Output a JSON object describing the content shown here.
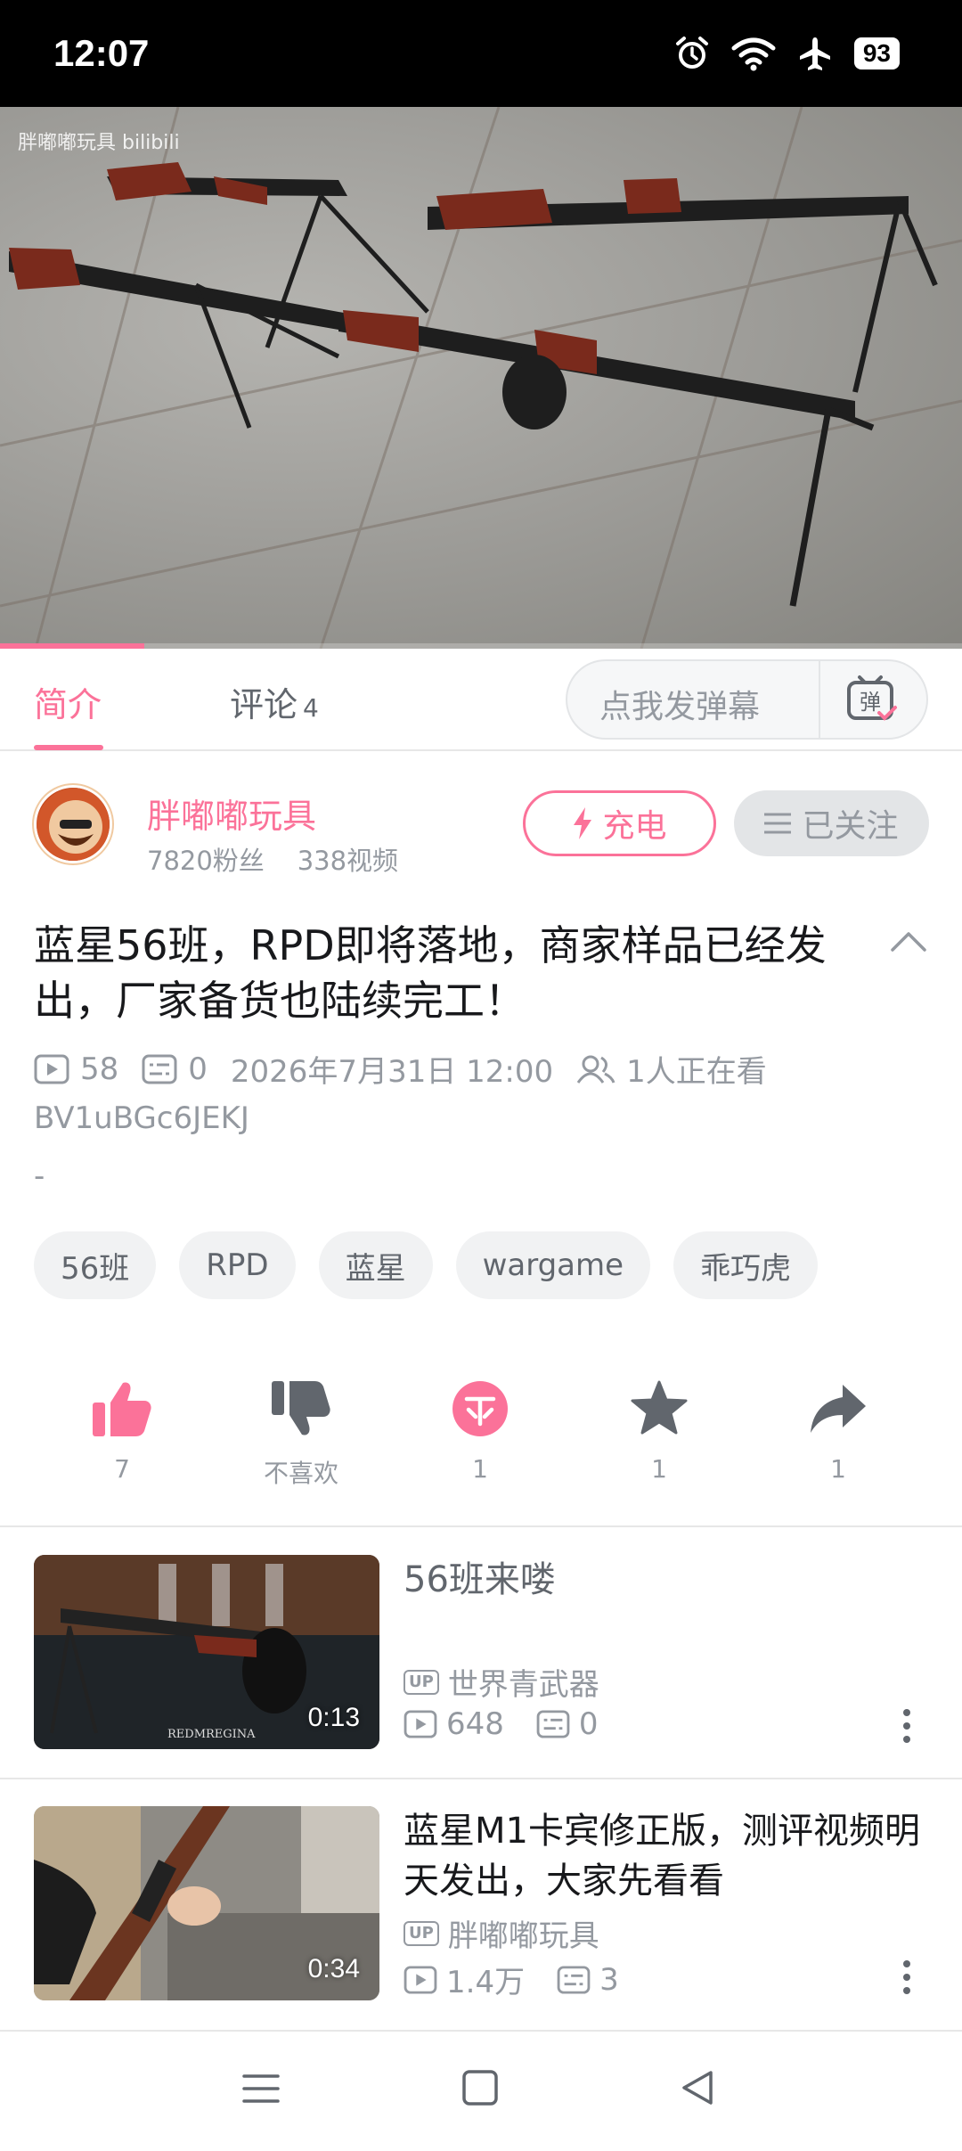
{
  "status_bar": {
    "time": "12:07",
    "battery": "93",
    "icons": [
      "alarm-icon",
      "wifi-icon",
      "airplane-icon",
      "battery-icon"
    ]
  },
  "player": {
    "watermark": "胖嘟嘟玩具 bilibili",
    "progress": 0.15
  },
  "tabs": [
    {
      "label": "简介",
      "count": ""
    },
    {
      "label": "评论",
      "count": "4"
    }
  ],
  "danmaku": {
    "placeholder": "点我发弹幕",
    "icon_label": "弹"
  },
  "uploader": {
    "name": "胖嘟嘟玩具",
    "fans": "7820粉丝",
    "videos": "338视频",
    "charge_label": "充电",
    "follow_label": "已关注"
  },
  "video": {
    "title": "蓝星56班，RPD即将落地，商家样品已经发出，厂家备货也陆续完工！",
    "plays": "58",
    "danmaku_count": "0",
    "date": "2026年7月31日 12:00",
    "watching": "1人正在看",
    "bvid": "BV1uBGc6JEKJ",
    "description": "-"
  },
  "tags": [
    "56班",
    "RPD",
    "蓝星",
    "wargame",
    "乖巧虎"
  ],
  "actions": [
    {
      "name": "like",
      "label": "7"
    },
    {
      "name": "dislike",
      "label": "不喜欢"
    },
    {
      "name": "coin",
      "label": "1"
    },
    {
      "name": "favorite",
      "label": "1"
    },
    {
      "name": "share",
      "label": "1"
    }
  ],
  "recommendations": [
    {
      "title": "56班来喽",
      "duration": "0:13",
      "uploader": "世界青武器",
      "plays": "648",
      "danmaku": "0",
      "thumb_text": "REDMREGINA"
    },
    {
      "title": "蓝星M1卡宾修正版，测评视频明天发出，大家先看看",
      "duration": "0:34",
      "uploader": "胖嘟嘟玩具",
      "plays": "1.4万",
      "danmaku": "3"
    }
  ],
  "up_badge": "UP",
  "colors": {
    "accent": "#fb7299",
    "text": "#18191c",
    "muted": "#9499a0"
  }
}
